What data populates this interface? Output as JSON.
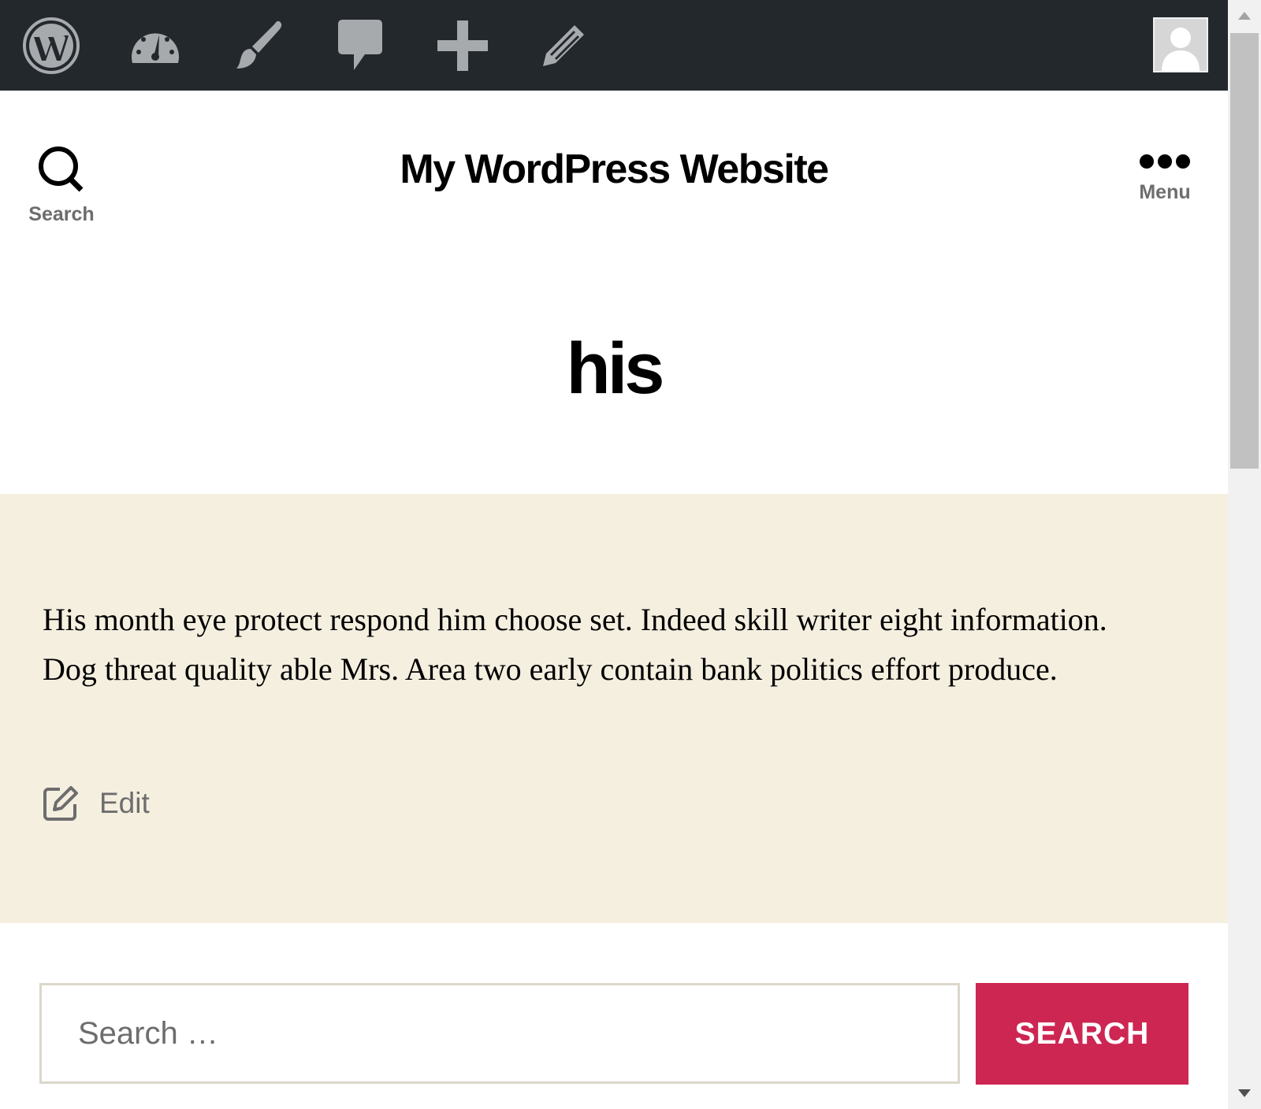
{
  "admin_bar": {
    "icons": [
      "wordpress-logo-icon",
      "dashboard-gauge-icon",
      "customize-brush-icon",
      "comments-bubble-icon",
      "plus-new-icon",
      "pencil-edit-icon"
    ],
    "avatar_icon": "user-avatar-icon",
    "background_color": "#23282d",
    "icon_color": "#a7aaad"
  },
  "header": {
    "site_title": "My WordPress Website",
    "search_label": "Search",
    "menu_label": "Menu"
  },
  "page": {
    "title": "his"
  },
  "content": {
    "paragraph": "His month eye protect respond him choose set. Indeed skill writer eight information. Dog threat quality able Mrs. Area two early contain bank politics effort produce.",
    "edit_label": "Edit",
    "band_color": "#f5efe0"
  },
  "search_form": {
    "placeholder": "Search …",
    "value": "",
    "button_label": "SEARCH",
    "accent_color": "#cd2653"
  }
}
